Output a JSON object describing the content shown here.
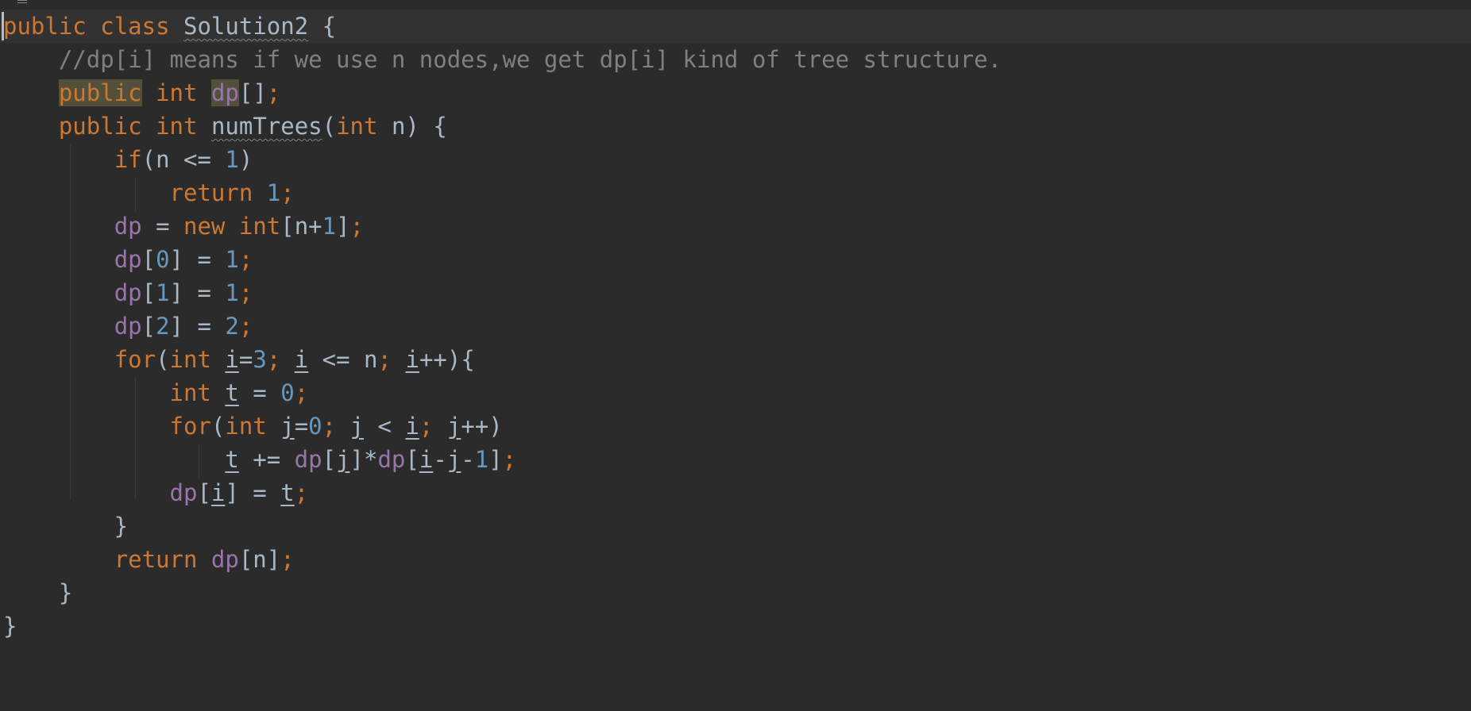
{
  "editor": {
    "language": "Java",
    "colors": {
      "background": "#2b2b2b",
      "current_line": "#323232",
      "keyword": "#cc7832",
      "comment": "#808080",
      "field": "#9876aa",
      "number": "#6897bb",
      "text": "#a9b7c6",
      "usage_highlight": "#52503a"
    },
    "caret": {
      "line": 1,
      "column": 1
    },
    "lines": [
      [
        [
          "public",
          "keyword"
        ],
        [
          " ",
          "text"
        ],
        [
          "class",
          "keyword"
        ],
        [
          " ",
          "text"
        ],
        [
          "Solution2",
          "unused"
        ],
        [
          " {",
          "text"
        ]
      ],
      [
        [
          "    ",
          "text"
        ],
        [
          "//dp[i] means if we use n nodes,we get dp[i] kind of tree structure.",
          "comment"
        ]
      ],
      [
        [
          "    ",
          "text"
        ],
        [
          "public",
          "keyword highlight"
        ],
        [
          " ",
          "text"
        ],
        [
          "int",
          "keyword"
        ],
        [
          " ",
          "text"
        ],
        [
          "dp",
          "field highlight"
        ],
        [
          "[]",
          "text"
        ],
        [
          ";",
          "semicolon"
        ]
      ],
      [
        [
          "    ",
          "text"
        ],
        [
          "public",
          "keyword"
        ],
        [
          " ",
          "text"
        ],
        [
          "int",
          "keyword"
        ],
        [
          " ",
          "text"
        ],
        [
          "numTrees",
          "unused"
        ],
        [
          "(",
          "text"
        ],
        [
          "int",
          "keyword"
        ],
        [
          " n) {",
          "text"
        ]
      ],
      [
        [
          "        ",
          "text"
        ],
        [
          "if",
          "keyword"
        ],
        [
          "(n <= ",
          "text"
        ],
        [
          "1",
          "number"
        ],
        [
          ")",
          "text"
        ]
      ],
      [
        [
          "            ",
          "text"
        ],
        [
          "return",
          "keyword"
        ],
        [
          " ",
          "text"
        ],
        [
          "1",
          "number"
        ],
        [
          ";",
          "semicolon"
        ]
      ],
      [
        [
          "        ",
          "text"
        ],
        [
          "dp",
          "field"
        ],
        [
          " = ",
          "text"
        ],
        [
          "new",
          "keyword"
        ],
        [
          " ",
          "text"
        ],
        [
          "int",
          "keyword"
        ],
        [
          "[n+",
          "text"
        ],
        [
          "1",
          "number"
        ],
        [
          "]",
          "text"
        ],
        [
          ";",
          "semicolon"
        ]
      ],
      [
        [
          "        ",
          "text"
        ],
        [
          "dp",
          "field"
        ],
        [
          "[",
          "text"
        ],
        [
          "0",
          "number"
        ],
        [
          "] = ",
          "text"
        ],
        [
          "1",
          "number"
        ],
        [
          ";",
          "semicolon"
        ]
      ],
      [
        [
          "        ",
          "text"
        ],
        [
          "dp",
          "field"
        ],
        [
          "[",
          "text"
        ],
        [
          "1",
          "number"
        ],
        [
          "] = ",
          "text"
        ],
        [
          "1",
          "number"
        ],
        [
          ";",
          "semicolon"
        ]
      ],
      [
        [
          "        ",
          "text"
        ],
        [
          "dp",
          "field"
        ],
        [
          "[",
          "text"
        ],
        [
          "2",
          "number"
        ],
        [
          "] = ",
          "text"
        ],
        [
          "2",
          "number"
        ],
        [
          ";",
          "semicolon"
        ]
      ],
      [
        [
          "        ",
          "text"
        ],
        [
          "for",
          "keyword"
        ],
        [
          "(",
          "text"
        ],
        [
          "int",
          "keyword"
        ],
        [
          " ",
          "text"
        ],
        [
          "i",
          "underline"
        ],
        [
          "=",
          "text"
        ],
        [
          "3",
          "number"
        ],
        [
          ";",
          "semicolon"
        ],
        [
          " ",
          "text"
        ],
        [
          "i",
          "underline"
        ],
        [
          " <= n",
          "text"
        ],
        [
          ";",
          "semicolon"
        ],
        [
          " ",
          "text"
        ],
        [
          "i",
          "underline"
        ],
        [
          "++){",
          "text"
        ]
      ],
      [
        [
          "            ",
          "text"
        ],
        [
          "int",
          "keyword"
        ],
        [
          " ",
          "text"
        ],
        [
          "t",
          "underline"
        ],
        [
          " = ",
          "text"
        ],
        [
          "0",
          "number"
        ],
        [
          ";",
          "semicolon"
        ]
      ],
      [
        [
          "            ",
          "text"
        ],
        [
          "for",
          "keyword"
        ],
        [
          "(",
          "text"
        ],
        [
          "int",
          "keyword"
        ],
        [
          " ",
          "text"
        ],
        [
          "j",
          "underline"
        ],
        [
          "=",
          "text"
        ],
        [
          "0",
          "number"
        ],
        [
          ";",
          "semicolon"
        ],
        [
          " ",
          "text"
        ],
        [
          "j",
          "underline"
        ],
        [
          " < ",
          "text"
        ],
        [
          "i",
          "underline"
        ],
        [
          ";",
          "semicolon"
        ],
        [
          " ",
          "text"
        ],
        [
          "j",
          "underline"
        ],
        [
          "++)",
          "text"
        ]
      ],
      [
        [
          "                ",
          "text"
        ],
        [
          "t",
          "underline"
        ],
        [
          " += ",
          "text"
        ],
        [
          "dp",
          "field"
        ],
        [
          "[",
          "text"
        ],
        [
          "j",
          "underline"
        ],
        [
          "]*",
          "text"
        ],
        [
          "dp",
          "field"
        ],
        [
          "[",
          "text"
        ],
        [
          "i",
          "underline"
        ],
        [
          "-",
          "text"
        ],
        [
          "j",
          "underline"
        ],
        [
          "-",
          "text"
        ],
        [
          "1",
          "number"
        ],
        [
          "]",
          "text"
        ],
        [
          ";",
          "semicolon"
        ]
      ],
      [
        [
          "            ",
          "text"
        ],
        [
          "dp",
          "field"
        ],
        [
          "[",
          "text"
        ],
        [
          "i",
          "underline"
        ],
        [
          "] = ",
          "text"
        ],
        [
          "t",
          "underline"
        ],
        [
          ";",
          "semicolon"
        ]
      ],
      [
        [
          "        }",
          "text"
        ]
      ],
      [
        [
          "        ",
          "text"
        ],
        [
          "return",
          "keyword"
        ],
        [
          " ",
          "text"
        ],
        [
          "dp",
          "field"
        ],
        [
          "[n]",
          "text"
        ],
        [
          ";",
          "semicolon"
        ]
      ],
      [
        [
          "    }",
          "text"
        ]
      ],
      [
        [
          "}",
          "text"
        ]
      ]
    ]
  }
}
